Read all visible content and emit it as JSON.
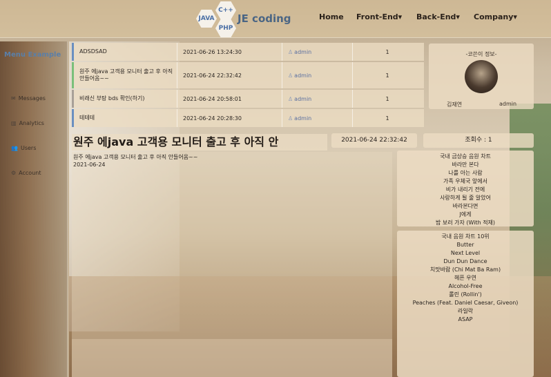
{
  "header": {
    "logo": {
      "java": "JAVA",
      "cpp": "C++",
      "php": "PHP",
      "text": "JE coding"
    },
    "nav": [
      {
        "label": "Home"
      },
      {
        "label": "Front-End▾"
      },
      {
        "label": "Back-End▾"
      },
      {
        "label": "Company▾"
      }
    ]
  },
  "sidebar": {
    "title": "Menu Example",
    "items": [
      {
        "label": "Messages",
        "icon": "envelope-icon",
        "glyph": "✉"
      },
      {
        "label": "Analytics",
        "icon": "bar-chart-icon",
        "glyph": "▥"
      },
      {
        "label": "Users",
        "icon": "users-icon",
        "glyph": "👥"
      },
      {
        "label": "Account",
        "icon": "gear-icon",
        "glyph": "⚙"
      }
    ]
  },
  "post_list": {
    "rows": [
      {
        "title": "ADSDSAD",
        "date": "2021-06-26 13:24:30",
        "author": "admin",
        "count": "1"
      },
      {
        "title": "원주 에java 고객용 모니터 출고 후 아직 안들어옴~~",
        "date": "2021-06-24 22:32:42",
        "author": "admin",
        "count": "1"
      },
      {
        "title": "비래신 부탕 bds 확인(하기)",
        "date": "2021-06-24 20:58:01",
        "author": "admin",
        "count": "1"
      },
      {
        "title": "테테테",
        "date": "2021-06-24 20:28:30",
        "author": "admin",
        "count": "1"
      }
    ]
  },
  "user_card": {
    "heading": "-코쓴이 정보-",
    "name": "김재연",
    "id": "admin"
  },
  "post": {
    "title": "원주 에java 고객용 모니터 출고 후 아직 안",
    "date": "2021-06-24 22:32:42",
    "views": "조회수 : 1",
    "body": "원주 에java 고객용 모니터 출고 후 아직 안들어옴~~",
    "body_date": "2021-06-24"
  },
  "chart_panel_1": {
    "items": [
      "국내 금상승 음원 차트",
      "바라만 본다",
      "나를 아는 사람",
      "가족 우체국 앞에서",
      "비가 내리기 전에",
      "사랑하게 될 줄 알았어",
      "바라본다면",
      "J에게",
      "밤 보러 가자 (With 적재)"
    ]
  },
  "chart_panel_2": {
    "items": [
      "국내 음원 차트 10위",
      "Butter",
      "Next Level",
      "Dun Dun Dance",
      "치맛바람 (Chi Mat Ba Ram)",
      "헤픈 우연",
      "Alcohol-Free",
      "롤린 (Rollin')",
      "Peaches (Feat. Daniel Caesar, Giveon)",
      "라일락",
      "ASAP"
    ]
  }
}
